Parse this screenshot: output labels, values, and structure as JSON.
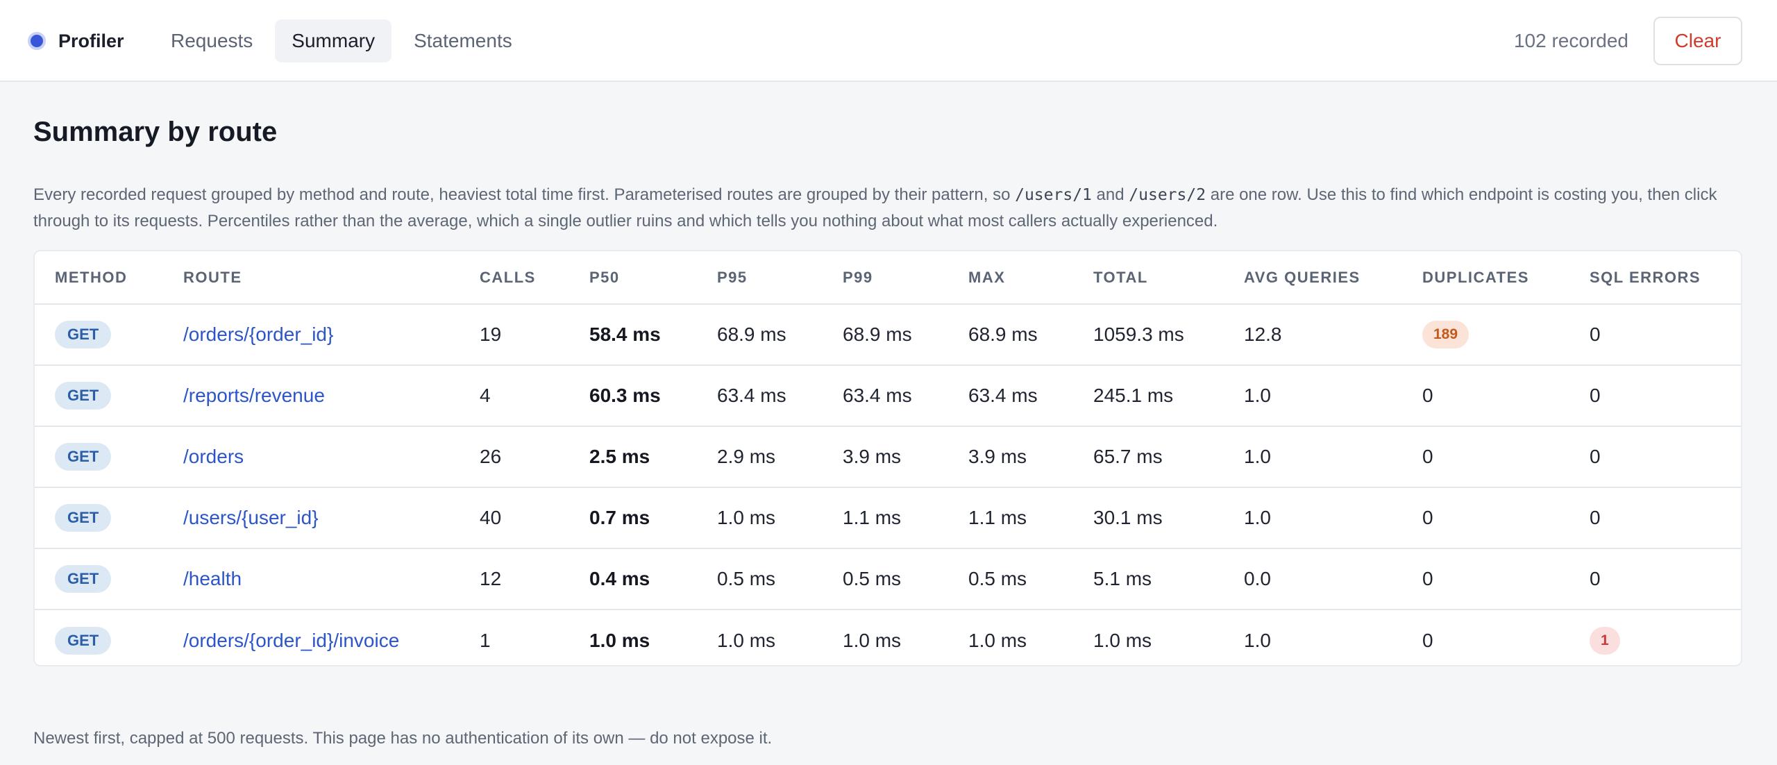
{
  "nav": {
    "brand": "Profiler",
    "tabs": [
      {
        "label": "Requests",
        "active": false
      },
      {
        "label": "Summary",
        "active": true
      },
      {
        "label": "Statements",
        "active": false
      }
    ],
    "recorded": "102 recorded",
    "clear_label": "Clear"
  },
  "page": {
    "title": "Summary by route",
    "desc_part1": "Every recorded request grouped by method and route, heaviest total time first. Parameterised routes are grouped by their pattern, so ",
    "desc_code1": "/users/1",
    "desc_and": " and ",
    "desc_code2": "/users/2",
    "desc_part2": " are one row. Use this to find which endpoint is costing you, then click through to its requests. Percentiles rather than the average, which a single outlier ruins and which tells you nothing about what most callers actually experienced.",
    "footer": "Newest first, capped at 500 requests. This page has no authentication of its own — do not expose it."
  },
  "table": {
    "headers": {
      "method": "METHOD",
      "route": "ROUTE",
      "calls": "CALLS",
      "p50": "P50",
      "p95": "P95",
      "p99": "P99",
      "max": "MAX",
      "total": "TOTAL",
      "avg_queries": "AVG QUERIES",
      "duplicates": "DUPLICATES",
      "sql_errors": "SQL ERRORS"
    },
    "rows": [
      {
        "method": "GET",
        "route": "/orders/{order_id}",
        "calls": "19",
        "p50": "58.4 ms",
        "p95": "68.9 ms",
        "p99": "68.9 ms",
        "max": "68.9 ms",
        "total": "1059.3 ms",
        "avg_queries": "12.8",
        "duplicates": "189",
        "dup_badge": true,
        "sql_errors": "0",
        "err_badge": false
      },
      {
        "method": "GET",
        "route": "/reports/revenue",
        "calls": "4",
        "p50": "60.3 ms",
        "p95": "63.4 ms",
        "p99": "63.4 ms",
        "max": "63.4 ms",
        "total": "245.1 ms",
        "avg_queries": "1.0",
        "duplicates": "0",
        "dup_badge": false,
        "sql_errors": "0",
        "err_badge": false
      },
      {
        "method": "GET",
        "route": "/orders",
        "calls": "26",
        "p50": "2.5 ms",
        "p95": "2.9 ms",
        "p99": "3.9 ms",
        "max": "3.9 ms",
        "total": "65.7 ms",
        "avg_queries": "1.0",
        "duplicates": "0",
        "dup_badge": false,
        "sql_errors": "0",
        "err_badge": false
      },
      {
        "method": "GET",
        "route": "/users/{user_id}",
        "calls": "40",
        "p50": "0.7 ms",
        "p95": "1.0 ms",
        "p99": "1.1 ms",
        "max": "1.1 ms",
        "total": "30.1 ms",
        "avg_queries": "1.0",
        "duplicates": "0",
        "dup_badge": false,
        "sql_errors": "0",
        "err_badge": false
      },
      {
        "method": "GET",
        "route": "/health",
        "calls": "12",
        "p50": "0.4 ms",
        "p95": "0.5 ms",
        "p99": "0.5 ms",
        "max": "0.5 ms",
        "total": "5.1 ms",
        "avg_queries": "0.0",
        "duplicates": "0",
        "dup_badge": false,
        "sql_errors": "0",
        "err_badge": false
      },
      {
        "method": "GET",
        "route": "/orders/{order_id}/invoice",
        "calls": "1",
        "p50": "1.0 ms",
        "p95": "1.0 ms",
        "p99": "1.0 ms",
        "max": "1.0 ms",
        "total": "1.0 ms",
        "avg_queries": "1.0",
        "duplicates": "0",
        "dup_badge": false,
        "sql_errors": "1",
        "err_badge": true
      }
    ]
  }
}
